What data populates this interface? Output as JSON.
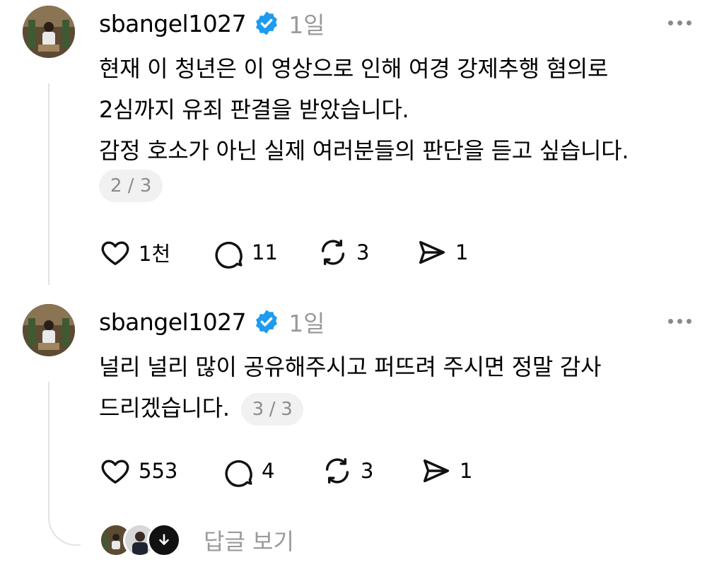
{
  "posts": [
    {
      "username": "sbangel1027",
      "time": "1일",
      "lines": [
        "현재 이 청년은 이 영상으로 인해 여경 강제추행 혐의로",
        "2심까지 유죄 판결을 받았습니다.",
        "감정 호소가 아닌 실제 여러분들의 판단을 듣고 싶습니다."
      ],
      "page_indicator": "2 / 3",
      "likes": "1천",
      "comments": "11",
      "reposts": "3",
      "shares": "1"
    },
    {
      "username": "sbangel1027",
      "time": "1일",
      "lines": [
        "널리 널리 많이 공유해주시고 퍼뜨려 주시면 정말 감사",
        "드리겠습니다."
      ],
      "page_indicator": "3 / 3",
      "likes": "553",
      "comments": "4",
      "reposts": "3",
      "shares": "1"
    }
  ],
  "view_replies_label": "답글 보기",
  "icons": {
    "verified": "verified-badge-icon",
    "like": "heart-icon",
    "comment": "comment-bubble-icon",
    "repost": "repost-icon",
    "share": "send-icon",
    "more": "more-options-icon",
    "expand": "arrow-down-icon"
  },
  "colors": {
    "verified": "#1d9bf0",
    "muted": "#9a9a9a",
    "pill_bg": "#f1f1f1"
  }
}
